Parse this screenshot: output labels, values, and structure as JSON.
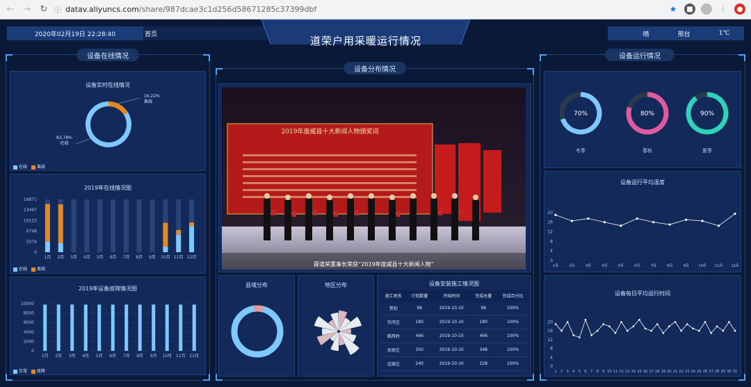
{
  "browser": {
    "back_icon": "arrow-left-icon",
    "forward_icon": "arrow-right-icon",
    "reload_icon": "reload-icon",
    "url_host": "datav.aliyuncs.com",
    "url_path": "/share/987dcae3c1d256d58671285c37399dbf"
  },
  "topbar": {
    "datetime": "2020年02月19日 22:28:40",
    "home": "首页",
    "weather": "晴",
    "city": "邢台",
    "temp": "1℃"
  },
  "title": "道荣户用采暖运行情况",
  "left": {
    "section_title": "设备在线情况",
    "online_panel": {
      "title": "设备实时在线情况",
      "offline_pct": "16.22%",
      "offline_label": "离线",
      "online_pct": "83.78%",
      "online_label": "在线",
      "legend_online": "在线",
      "legend_offline": "离线"
    },
    "monthly_panel": {
      "title": "2019年在线情况图",
      "legend_online": "在线",
      "legend_offline": "离线"
    },
    "fault_panel": {
      "title": "2019年设备故障情况图",
      "legend_normal": "正常",
      "legend_fault": "故障"
    }
  },
  "center": {
    "section_title": "设备分布情况",
    "photo_caption": "薛道荣董事长荣获“2019年度威县十大新闻人物”",
    "banner_title": "2019年度威县十大新闻人物颁奖词",
    "county_title": "县域分布",
    "region_title": "地区分布",
    "table": {
      "title": "设备安装施工情况图",
      "headers": [
        "施工地名",
        "计划数量",
        "开始时间",
        "完成总量",
        "完成百分比"
      ],
      "rows": [
        [
          "贺钊",
          "96",
          "2019-10-10",
          "96",
          "100%"
        ],
        [
          "刘河庄",
          "180",
          "2019-10-10",
          "180",
          "100%"
        ],
        [
          "临西村",
          "466",
          "2019-10-10",
          "466",
          "100%"
        ],
        [
          "太原庄",
          "350",
          "2019-10-10",
          "348",
          "100%"
        ],
        [
          "北谢庄",
          "240",
          "2019-10-10",
          "228",
          "100%"
        ]
      ]
    }
  },
  "right": {
    "section_title": "设备运行情况",
    "rings": [
      {
        "label": "冬季",
        "pct_text": "70%",
        "value": 0.7,
        "color": "#7ec8ff"
      },
      {
        "label": "春秋",
        "pct_text": "80%",
        "value": 0.8,
        "color": "#e05aa0"
      },
      {
        "label": "夏季",
        "pct_text": "90%",
        "value": 0.9,
        "color": "#2fd1b8"
      }
    ],
    "temp_panel": {
      "title": "设备运行平均温度"
    },
    "runtime_panel": {
      "title": "设备每日平均运行时间"
    }
  },
  "colors": {
    "online": "#7ec8ff",
    "offline": "#e08a2a",
    "bar_bg": "#2a4478",
    "line": "#ffffff",
    "accent": "#4aa3ff"
  },
  "chart_data": [
    {
      "type": "pie",
      "title": "设备实时在线情况",
      "labels": [
        "在线",
        "离线"
      ],
      "values": [
        83.78,
        16.22
      ]
    },
    {
      "type": "bar",
      "title": "2019年在线情况图",
      "categories": [
        "1月",
        "2月",
        "3月",
        "4月",
        "5月",
        "6月",
        "7月",
        "8月",
        "9月",
        "10月",
        "11月",
        "12月"
      ],
      "ticks": [
        16871,
        13497,
        10123,
        6748,
        3374,
        0
      ],
      "ylim": [
        0,
        16871
      ],
      "series": [
        {
          "name": "在线",
          "values": [
            3400,
            2900,
            0,
            0,
            0,
            0,
            0,
            0,
            0,
            1800,
            5600,
            8400
          ]
        },
        {
          "name": "离线",
          "values": [
            12000,
            12400,
            0,
            0,
            0,
            0,
            0,
            0,
            0,
            7600,
            1500,
            1100
          ]
        }
      ]
    },
    {
      "type": "bar",
      "title": "2019年设备故障情况图",
      "categories": [
        "1月",
        "2月",
        "3月",
        "4月",
        "5月",
        "6月",
        "7月",
        "8月",
        "9月",
        "10月",
        "11月",
        "12月"
      ],
      "ticks": [
        10000,
        8000,
        6000,
        4000,
        2000,
        0
      ],
      "ylim": [
        0,
        10000
      ],
      "series": [
        {
          "name": "正常",
          "values": [
            9800,
            9800,
            9800,
            9800,
            9800,
            9800,
            9800,
            9800,
            9800,
            9800,
            9800,
            9800
          ]
        },
        {
          "name": "故障",
          "values": [
            0,
            0,
            0,
            0,
            0,
            0,
            0,
            0,
            0,
            0,
            0,
            0
          ]
        }
      ]
    },
    {
      "type": "line",
      "title": "设备运行平均温度",
      "categories": [
        "1月",
        "2月",
        "3月",
        "4月",
        "5月",
        "6月",
        "7月",
        "8月",
        "9月",
        "10月",
        "11月",
        "12月"
      ],
      "ticks": [
        20,
        16,
        12,
        8,
        4,
        0
      ],
      "ylim": [
        0,
        22
      ],
      "values": [
        19,
        16.5,
        17.5,
        16,
        14.5,
        17.5,
        16,
        15,
        17,
        16.5,
        14.5,
        19.5
      ]
    },
    {
      "type": "line",
      "title": "设备每日平均运行时间",
      "categories": [
        "1",
        "2",
        "3",
        "4",
        "5",
        "6",
        "7",
        "8",
        "9",
        "10",
        "11",
        "12",
        "13",
        "14",
        "15",
        "16",
        "17",
        "18",
        "19",
        "20",
        "21",
        "22",
        "23",
        "24",
        "25",
        "26",
        "27",
        "28",
        "29",
        "30",
        "31"
      ],
      "ticks": [
        20,
        16,
        12,
        8,
        4,
        0
      ],
      "ylim": [
        0,
        22
      ],
      "values": [
        19,
        16,
        20,
        14,
        13,
        21,
        14,
        16,
        19,
        18,
        15,
        20,
        16,
        18,
        21,
        17,
        16,
        19,
        15,
        18,
        20,
        16,
        19,
        17,
        16,
        20,
        15,
        18,
        16,
        20,
        16
      ]
    }
  ]
}
